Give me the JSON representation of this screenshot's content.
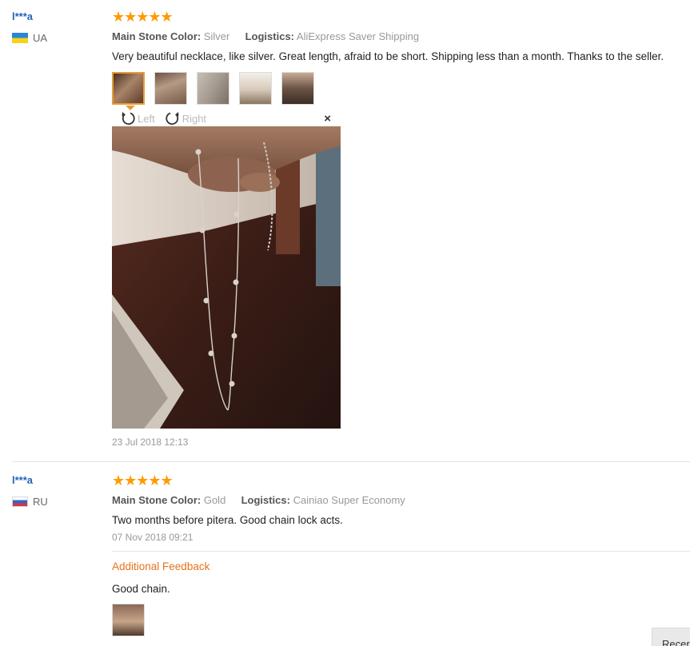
{
  "reviews": [
    {
      "user": "l***a",
      "country": "UA",
      "stars": "★★★★★",
      "attrs": {
        "stone_key": "Main Stone Color:",
        "stone_val": "Silver",
        "logistics_key": "Logistics:",
        "logistics_val": "AliExpress Saver Shipping"
      },
      "text": "Very beautiful necklace, like silver. Great length, afraid to be short. Shipping less than a month. Thanks to the seller.",
      "viewer": {
        "left_label": "Left",
        "right_label": "Right",
        "close": "×"
      },
      "date": "23 Jul 2018 12:13"
    },
    {
      "user": "l***a",
      "country": "RU",
      "stars": "★★★★★",
      "attrs": {
        "stone_key": "Main Stone Color:",
        "stone_val": "Gold",
        "logistics_key": "Logistics:",
        "logistics_val": "Cainiao Super Economy"
      },
      "text": "Two months before pitera. Good chain lock acts.",
      "date": "07 Nov 2018 09:21",
      "additional_label": "Additional Feedback",
      "additional_text": "Good chain."
    }
  ],
  "recent_button": "Recer",
  "colors": {
    "accent": "#ff9a00",
    "link": "#2463b7",
    "additional": "#e8721a"
  }
}
